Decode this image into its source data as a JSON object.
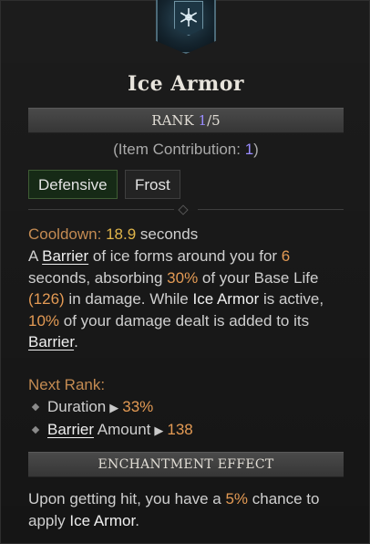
{
  "skill": {
    "icon": "snowflake-icon",
    "name": "Ice Armor",
    "rank_label": "RANK",
    "rank_current": "1",
    "rank_sep_max": "/5",
    "contribution_prefix": "(Item Contribution: ",
    "contribution_value": "1",
    "contribution_suffix": ")",
    "tags": [
      "Defensive",
      "Frost"
    ]
  },
  "description": {
    "cooldown_label": "Cooldown: ",
    "cooldown_value": "18.9",
    "cooldown_unit": " seconds",
    "p1": "A ",
    "barrier1": "Barrier",
    "p2": " of ice forms around you for ",
    "duration": "6",
    "p3": " seconds, absorbing ",
    "pct_life": "30%",
    "p4": " of your Base Life ",
    "life_value": "(126)",
    "p5": " in damage. While ",
    "ice_armor": "Ice Armor",
    "p6": " is active, ",
    "pct_damage": "10%",
    "p7": " of your damage dealt is added to its ",
    "barrier2": "Barrier",
    "p8": "."
  },
  "next_rank": {
    "label": "Next Rank:",
    "items": [
      {
        "label": "Duration",
        "arrow": "▶",
        "value": "33%"
      },
      {
        "label_link": "Barrier",
        "label_rest": " Amount",
        "arrow": "▶",
        "value": "138"
      }
    ]
  },
  "enchantment": {
    "header": "ENCHANTMENT EFFECT",
    "t1": "Upon getting hit, you have a ",
    "chance": "5%",
    "t2": " chance to apply ",
    "skill": "Ice Armor",
    "t3": "."
  },
  "colors": {
    "accent_number": "#9a8cff",
    "value_gold": "#e0b54a",
    "value_orange": "#e39a54",
    "defensive_tag_bg": "#162a16"
  }
}
